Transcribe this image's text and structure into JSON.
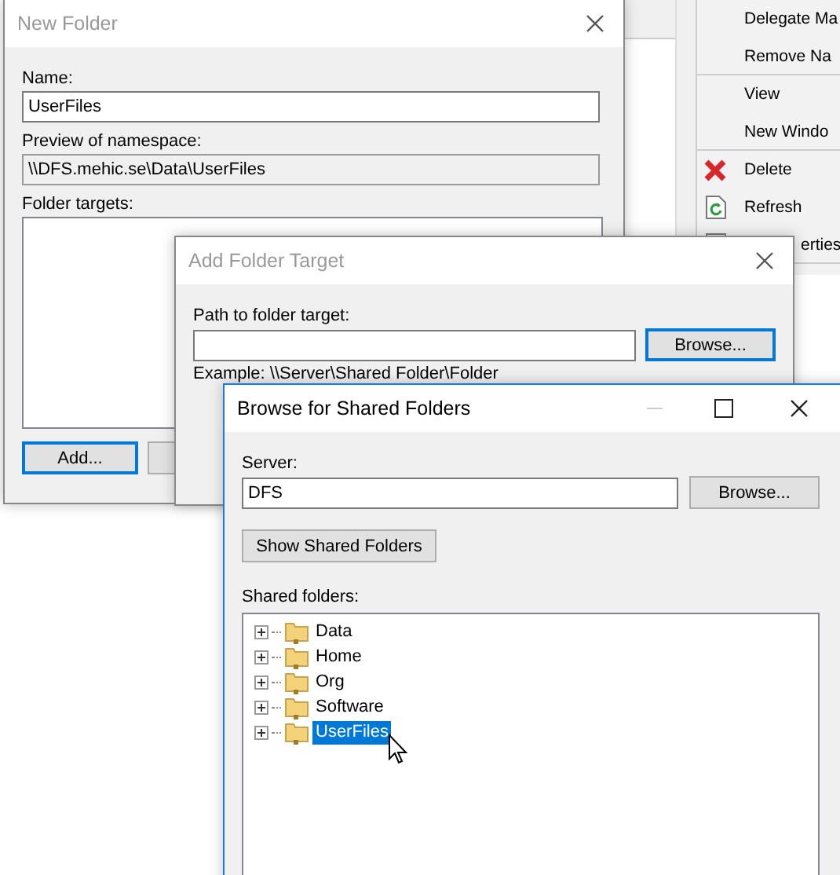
{
  "context_menu": {
    "items": [
      {
        "label": "Delegate Ma",
        "kind": "text",
        "separator_after": false
      },
      {
        "label": "Remove Na",
        "kind": "text",
        "separator_after": true
      },
      {
        "label": "View",
        "kind": "text",
        "separator_after": false
      },
      {
        "label": "New Windo",
        "kind": "text",
        "separator_after": true
      },
      {
        "label": "Delete",
        "kind": "delete",
        "separator_after": false
      },
      {
        "label": "Refresh",
        "kind": "refresh",
        "separator_after": false
      },
      {
        "label": "erties",
        "kind": "properties",
        "separator_after": true
      }
    ]
  },
  "new_folder": {
    "title": "New Folder",
    "name_label": "Name:",
    "name_value": "UserFiles",
    "preview_label": "Preview of namespace:",
    "preview_value": "\\\\DFS.mehic.se\\Data\\UserFiles",
    "targets_label": "Folder targets:",
    "add_button": "Add..."
  },
  "add_folder_target": {
    "title": "Add Folder Target",
    "path_label": "Path to folder target:",
    "browse_button": "Browse...",
    "example": "Example: \\\\Server\\Shared Folder\\Folder"
  },
  "browse_shared": {
    "title": "Browse for Shared Folders",
    "server_label": "Server:",
    "server_value": "DFS",
    "browse_button": "Browse...",
    "show_button": "Show Shared Folders",
    "folders_label": "Shared folders:",
    "folders": [
      {
        "label": "Data",
        "expanded": false,
        "selected": false
      },
      {
        "label": "Home",
        "expanded": false,
        "selected": false
      },
      {
        "label": "Org",
        "expanded": false,
        "selected": false
      },
      {
        "label": "Software",
        "expanded": false,
        "selected": false
      },
      {
        "label": "UserFiles",
        "expanded": false,
        "selected": true
      }
    ]
  }
}
